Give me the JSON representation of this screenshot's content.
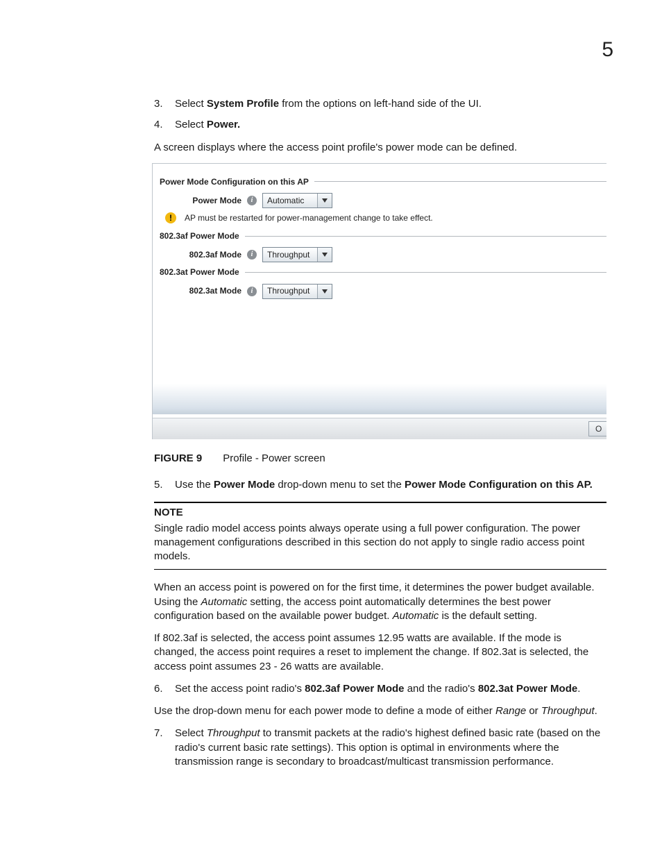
{
  "page_number": "5",
  "steps_a": [
    {
      "num": "3.",
      "pre": "Select ",
      "bold": "System Profile",
      "post": " from the options on left-hand side of the UI."
    },
    {
      "num": "4.",
      "pre": "Select ",
      "bold": "Power.",
      "post": ""
    }
  ],
  "intro_after_steps": "A screen displays where the access point profile's power mode can be defined.",
  "shot": {
    "section1_title": "Power Mode Configuration on this AP",
    "row1_label": "Power Mode",
    "row1_value": "Automatic",
    "warning": "AP must be restarted for power-management change to take effect.",
    "section2_title": "802.3af Power Mode",
    "row2_label": "802.3af Mode",
    "row2_value": "Throughput",
    "section3_title": "802.3at Power Mode",
    "row3_label": "802.3at Mode",
    "row3_value": "Throughput",
    "ok_fragment": "O"
  },
  "figure": {
    "label": "FIGURE 9",
    "caption": "Profile - Power screen"
  },
  "step5": {
    "num": "5.",
    "t1": "Use the ",
    "b1": "Power Mode",
    "t2": " drop-down menu to set the ",
    "b2": "Power Mode Configuration on this AP.",
    "t3": ""
  },
  "note": {
    "title": "NOTE",
    "body": "Single radio model access points always operate using a full power configuration. The power management configurations described in this section do not apply to single radio access point models."
  },
  "para_auto": {
    "t1": "When an access point is powered on for the first time, it determines the power budget available. Using the ",
    "i1": "Automatic",
    "t2": " setting, the access point automatically determines the best power configuration based on the available power budget. ",
    "i2": "Automatic",
    "t3": " is the default setting."
  },
  "para_af": "If 802.3af is selected, the access point assumes 12.95 watts are available. If the mode is changed, the access point requires a reset to implement the change. If 802.3at is selected, the access point assumes 23 - 26 watts are available.",
  "step6": {
    "num": "6.",
    "t1": "Set the access point radio's ",
    "b1": "802.3af Power Mode",
    "t2": " and the radio's ",
    "b2": "802.3at Power Mode",
    "t3": "."
  },
  "para_dd": {
    "t1": "Use the drop-down menu for each power mode to define a mode of either ",
    "i1": "Range",
    "t2": " or ",
    "i2": "Throughput",
    "t3": "."
  },
  "step7": {
    "num": "7.",
    "t1": "Select ",
    "i1": "Throughput",
    "t2": " to transmit packets at the radio's highest defined basic rate (based on the radio's current basic rate settings). This option is optimal in environments where the transmission range is secondary to broadcast/multicast transmission performance."
  }
}
